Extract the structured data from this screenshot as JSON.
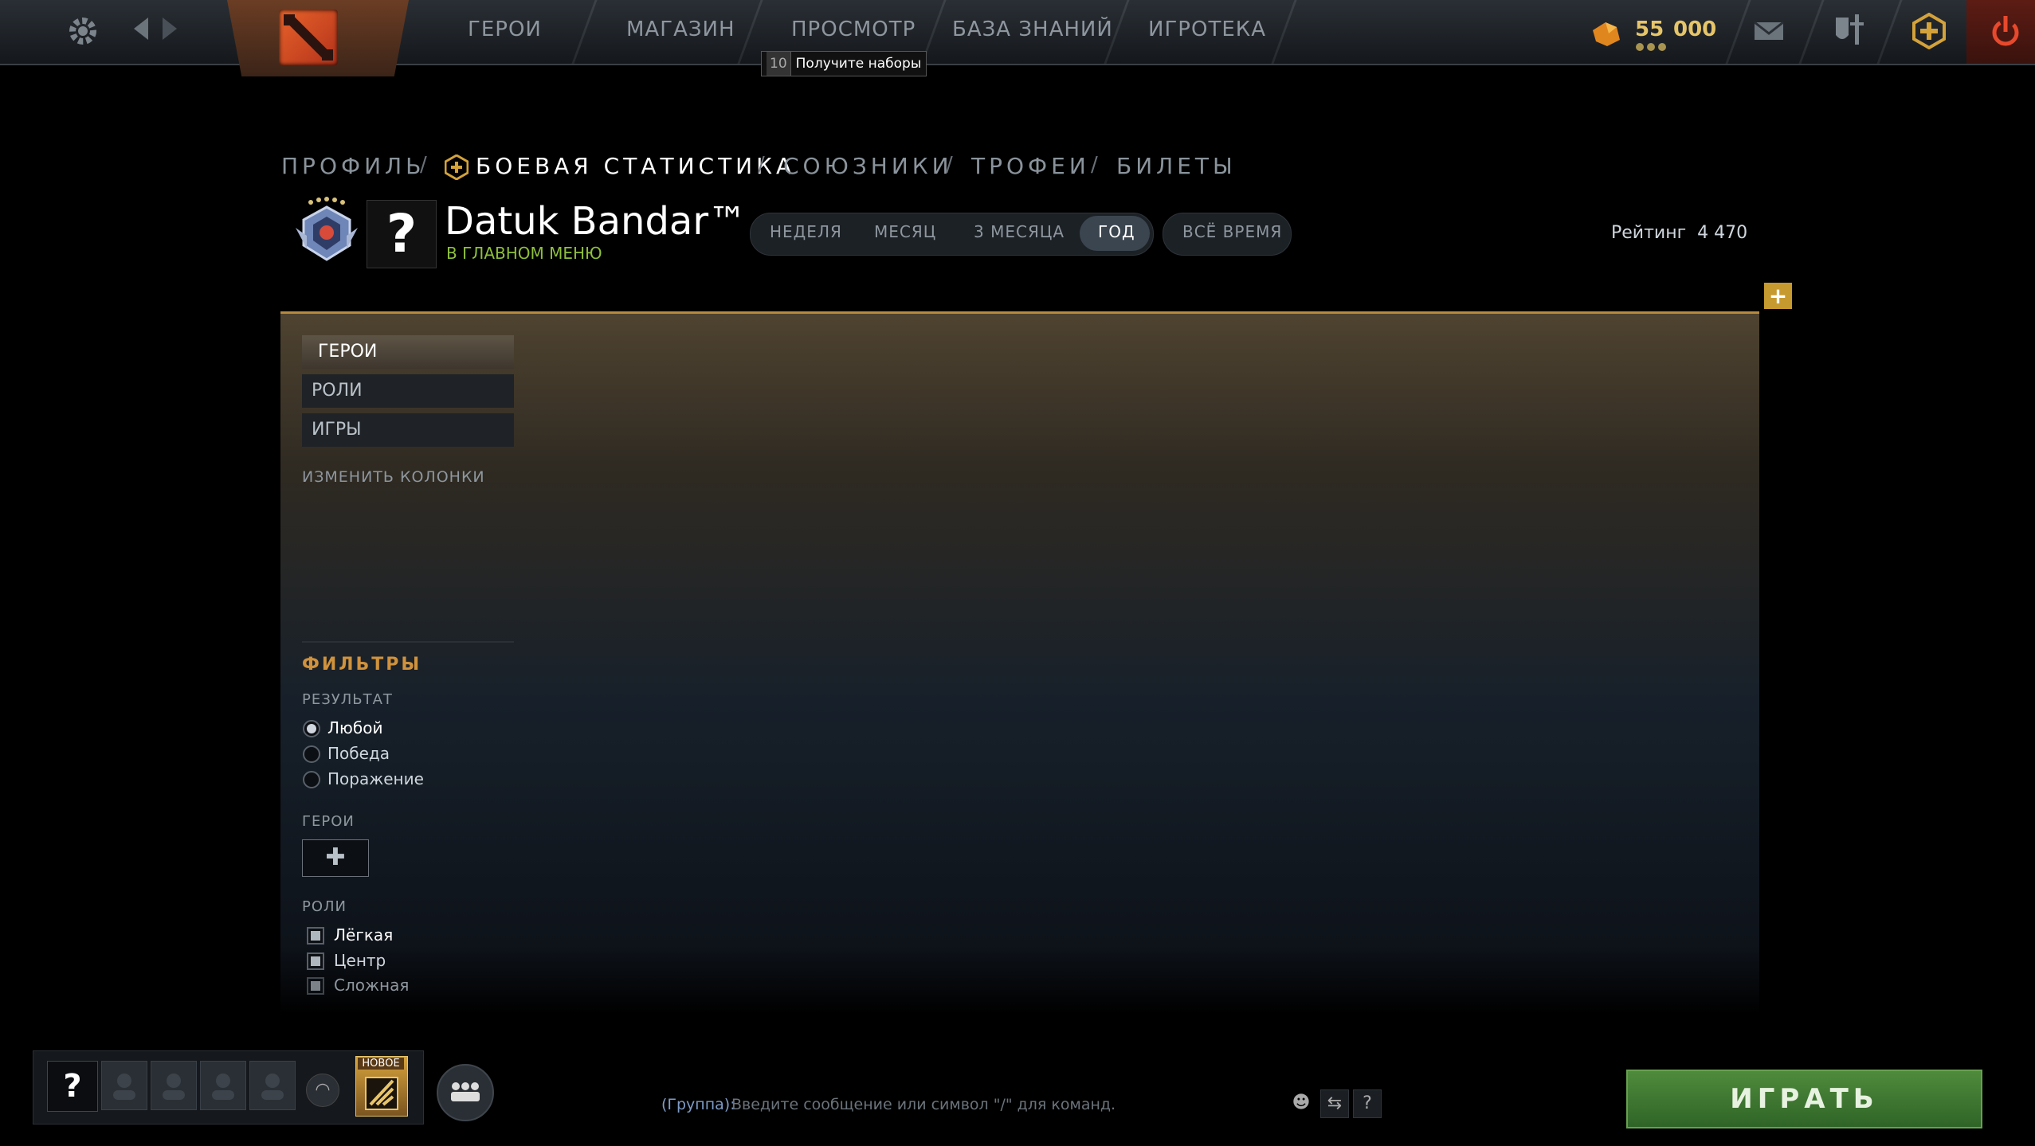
{
  "topbar": {
    "nav": [
      "ГЕРОИ",
      "МАГАЗИН",
      "ПРОСМОТР",
      "БАЗА ЗНАНИЙ",
      "ИГРОТЕКА"
    ],
    "tooltip_count": "10",
    "tooltip_text": "Получите наборы",
    "currency_main": "55",
    "currency_sub": "000"
  },
  "breadcrumb": [
    "ПРОФИЛЬ",
    "БОЕВАЯ СТАТИСТИКА",
    "СОЮЗНИКИ",
    "ТРОФЕИ",
    "БИЛЕТЫ"
  ],
  "profile": {
    "avatar_placeholder": "?",
    "name": "Datuk Bandar™",
    "status": "В ГЛАВНОМ МЕНЮ",
    "rating_label": "Рейтинг",
    "rating_value": "4 470"
  },
  "time_tabs": [
    "НЕДЕЛЯ",
    "МЕСЯЦ",
    "3 МЕСЯЦА",
    "ГОД",
    "ВСЁ ВРЕМЯ"
  ],
  "time_tab_selected": "ГОД",
  "sidebar": {
    "items": [
      "ГЕРОИ",
      "РОЛИ",
      "ИГРЫ"
    ],
    "edit_columns": "ИЗМЕНИТЬ КОЛОНКИ"
  },
  "filters": {
    "title": "ФИЛЬТРЫ",
    "result_label": "РЕЗУЛЬТАТ",
    "result_options": [
      "Любой",
      "Победа",
      "Поражение"
    ],
    "result_selected": "Любой",
    "heroes_label": "ГЕРОИ",
    "roles_label": "РОЛИ",
    "roles": [
      "Лёгкая",
      "Центр",
      "Сложная"
    ]
  },
  "bottom": {
    "self_slot": "?",
    "new_badge": "НОВОЕ",
    "chat_prefix": "(Группа):",
    "chat_placeholder": "Введите сообщение или символ \"/\" для команд.",
    "help_icon": "?",
    "play_label": "ИГРАТЬ"
  },
  "colors": {
    "accent_gold": "#c79a2f",
    "status_green": "#8ec03a",
    "filters_orange": "#d0923c",
    "play_green": "#3f7a33"
  }
}
